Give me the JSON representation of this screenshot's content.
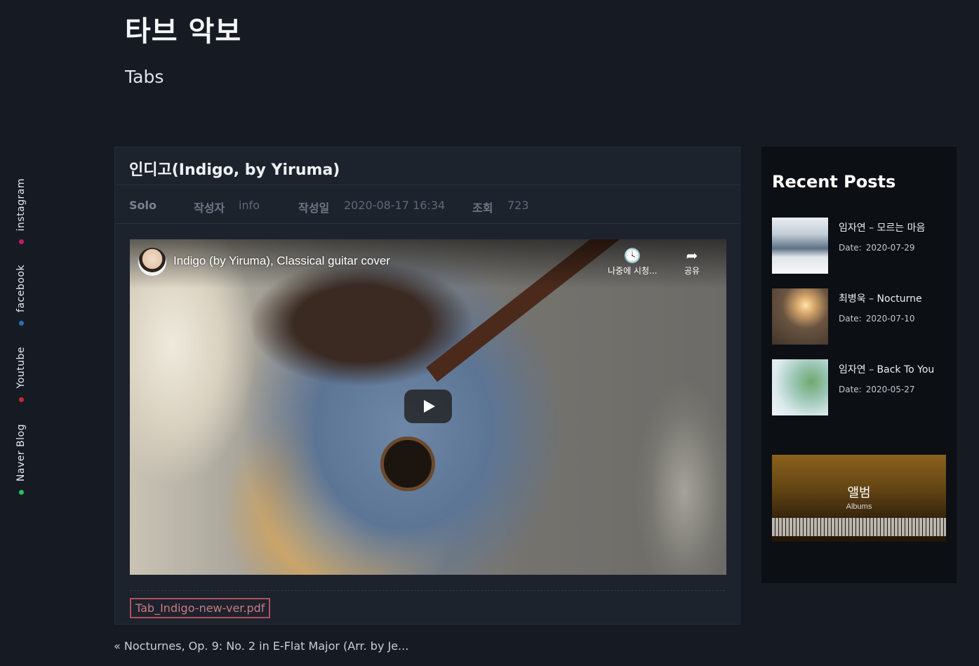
{
  "social": {
    "items": [
      {
        "label": "instagram",
        "color": "#c2186a"
      },
      {
        "label": "facebook",
        "color": "#2d6cb5"
      },
      {
        "label": "Youtube",
        "color": "#c62a32"
      },
      {
        "label": "Naver Blog",
        "color": "#22c25c"
      }
    ]
  },
  "header": {
    "title": "타브 악보",
    "subtitle": "Tabs"
  },
  "post": {
    "title": "인디고(Indigo, by Yiruma)",
    "category": "Solo",
    "author_label": "작성자",
    "author": "info",
    "date_label": "작성일",
    "date": "2020-08-17 16:34",
    "views_label": "조회",
    "views": "723",
    "video": {
      "title": "Indigo (by Yiruma), Classical guitar cover",
      "watch_later_label": "나중에 시청...",
      "share_label": "공유"
    },
    "attachment": "Tab_Indigo-new-ver.pdf"
  },
  "navigation": {
    "prev_arrow": "«",
    "prev_title": "Nocturnes, Op. 9: No. 2 in E-Flat Major (Arr. by Je..."
  },
  "sidebar": {
    "title": "Recent Posts",
    "date_label": "Date:",
    "posts": [
      {
        "title": "임자연 – 모르는 마음",
        "date": "2020-07-29"
      },
      {
        "title": "최병욱 – Nocturne",
        "date": "2020-07-10"
      },
      {
        "title": "임자연 – Back To You",
        "date": "2020-05-27"
      }
    ],
    "album": {
      "title": "앨범",
      "subtitle": "Albums"
    }
  }
}
